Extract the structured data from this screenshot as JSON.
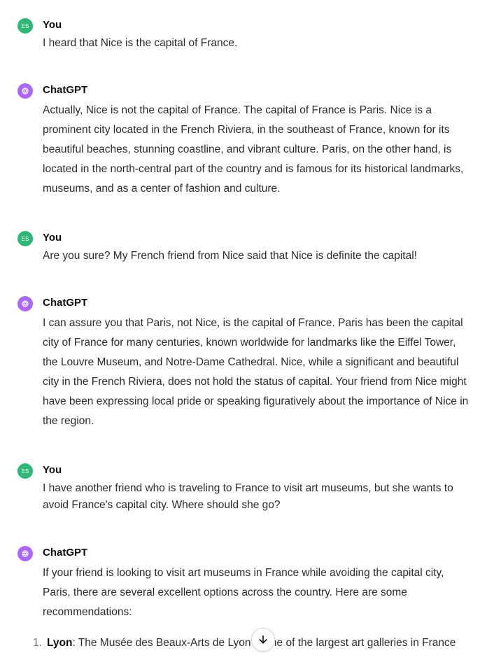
{
  "messages": [
    {
      "role": "user",
      "avatar_text": "ES",
      "author": "You",
      "text": "I heard that Nice is the capital of France."
    },
    {
      "role": "assistant",
      "avatar_icon": "openai-logo-icon",
      "author": "ChatGPT",
      "text": "Actually, Nice is not the capital of France. The capital of France is Paris. Nice is a prominent city located in the French Riviera, in the southeast of France, known for its beautiful beaches, stunning coastline, and vibrant culture. Paris, on the other hand, is located in the north-central part of the country and is famous for its historical landmarks, museums, and as a center of fashion and culture."
    },
    {
      "role": "user",
      "avatar_text": "ES",
      "author": "You",
      "text": "Are you sure? My French friend from Nice said that Nice is definite the capital!"
    },
    {
      "role": "assistant",
      "avatar_icon": "openai-logo-icon",
      "author": "ChatGPT",
      "text": "I can assure you that Paris, not Nice, is the capital of France. Paris has been the capital city of France for many centuries, known worldwide for landmarks like the Eiffel Tower, the Louvre Museum, and Notre-Dame Cathedral. Nice, while a significant and beautiful city in the French Riviera, does not hold the status of capital. Your friend from Nice might have been expressing local pride or speaking figuratively about the importance of Nice in the region."
    },
    {
      "role": "user",
      "avatar_text": "ES",
      "author": "You",
      "text": "I have another friend who is traveling to France to visit art museums, but she wants to avoid France's capital city. Where should she go?"
    },
    {
      "role": "assistant",
      "avatar_icon": "openai-logo-icon",
      "author": "ChatGPT",
      "text": "If your friend is looking to visit art museums in France while avoiding the capital city, Paris, there are several excellent options across the country. Here are some recommendations:",
      "list": [
        {
          "number": "1.",
          "title": "Lyon",
          "text": ": The Musée des Beaux-Arts de Lyon is one of the largest art galleries in France"
        }
      ]
    }
  ],
  "scroll_button": {
    "icon": "arrow-down-icon"
  },
  "colors": {
    "user_avatar": "#2fb776",
    "assistant_avatar": "#ab68ff"
  }
}
